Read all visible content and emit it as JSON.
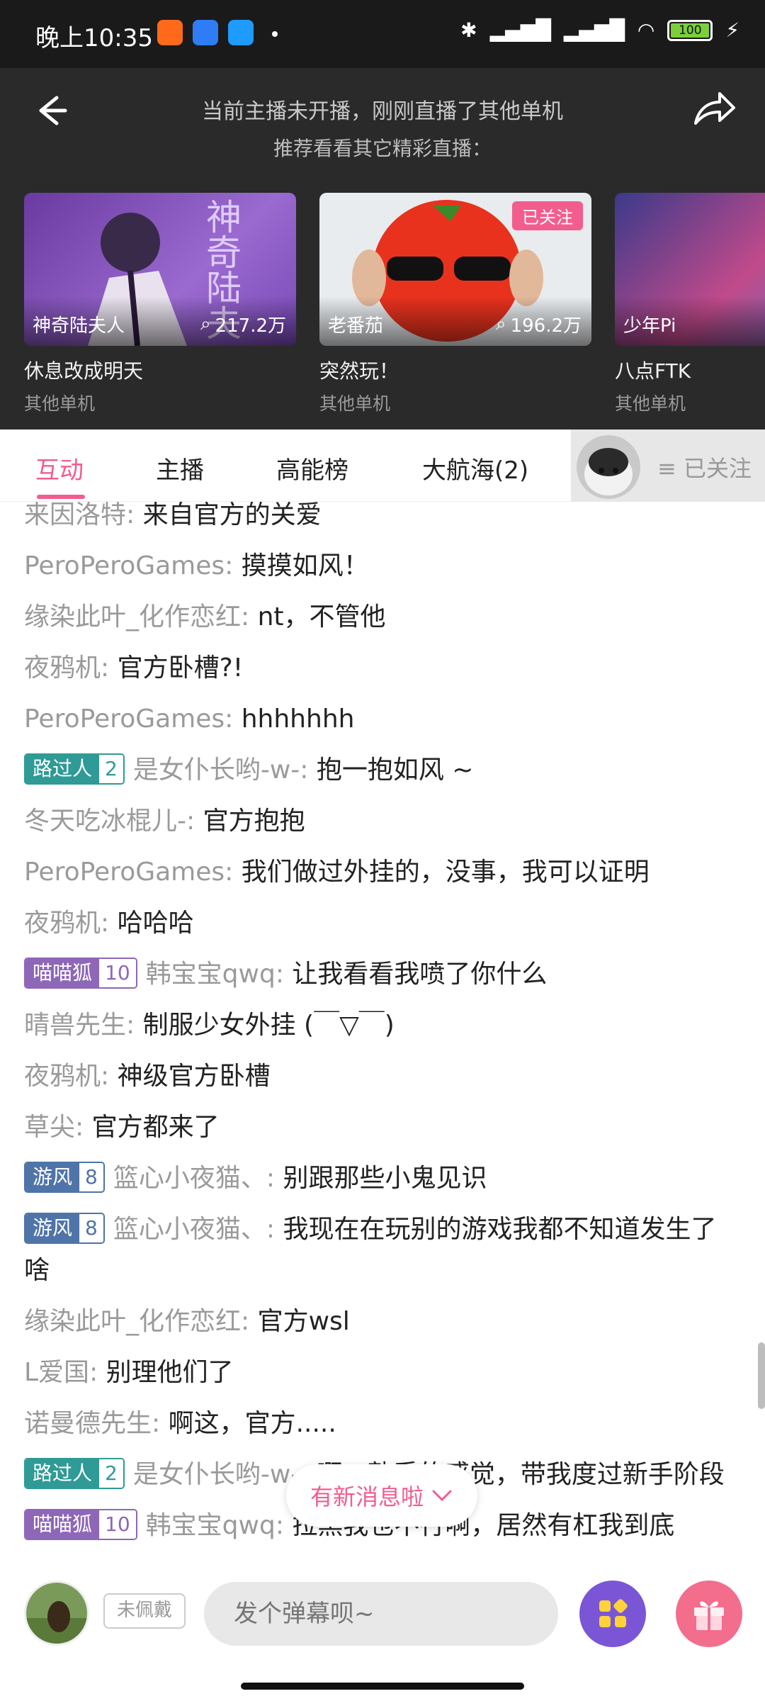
{
  "status_bar": {
    "time": "晚上10:35",
    "battery": "100"
  },
  "header": {
    "notice_line1": "当前主播未开播，刚刚直播了其他单机",
    "notice_line2": "推荐看看其它精彩直播："
  },
  "recommendations": [
    {
      "streamer": "神奇陆夫人",
      "viewers": "217.2万",
      "title": "休息改成明天",
      "category": "其他单机",
      "thumb_text": "神奇陆夫"
    },
    {
      "streamer": "老番茄",
      "viewers": "196.2万",
      "title": "突然玩！",
      "category": "其他单机",
      "followed_tag": "已关注"
    },
    {
      "streamer": "少年Pi",
      "viewers": "",
      "title": "八点FTK",
      "category": "其他单机"
    }
  ],
  "tabs": [
    {
      "label": "互动",
      "active": true
    },
    {
      "label": "主播"
    },
    {
      "label": "高能榜"
    },
    {
      "label": "大航海(2)"
    }
  ],
  "follow_button": "≡ 已关注",
  "chat": [
    {
      "user": "来因洛特",
      "text": "来自官方的关爱"
    },
    {
      "user": "PeroPeroGames",
      "text": "摸摸如风！"
    },
    {
      "user": "缘染此叶_化作恋红",
      "text": "nt，不管他"
    },
    {
      "user": "夜鸦机",
      "text": "官方卧槽?!"
    },
    {
      "user": "PeroPeroGames",
      "text": "hhhhhhh"
    },
    {
      "badge": {
        "name": "路过人",
        "level": "2",
        "color": "teal"
      },
      "user": "是女仆长哟-w-",
      "text": "抱一抱如风 ~"
    },
    {
      "user": "冬天吃冰棍儿-",
      "text": "官方抱抱"
    },
    {
      "user": "PeroPeroGames",
      "text": "我们做过外挂的，没事，我可以证明"
    },
    {
      "user": "夜鸦机",
      "text": "哈哈哈"
    },
    {
      "badge": {
        "name": "喵喵狐",
        "level": "10",
        "color": "purple"
      },
      "user": "韩宝宝qwq",
      "text": "让我看看我喷了你什么"
    },
    {
      "user": "晴兽先生",
      "text": "制服少女外挂 (￣▽￣)"
    },
    {
      "user": "夜鸦机",
      "text": "神级官方卧槽"
    },
    {
      "user": "草尖",
      "text": "官方都来了"
    },
    {
      "badge": {
        "name": "游风",
        "level": "8",
        "color": "blue"
      },
      "user": "篮心小夜猫、",
      "text": "别跟那些小鬼见识"
    },
    {
      "badge": {
        "name": "游风",
        "level": "8",
        "color": "blue"
      },
      "user": "篮心小夜猫、",
      "text": "我现在在玩别的游戏我都不知道发生了啥"
    },
    {
      "user": "缘染此叶_化作恋红",
      "text": "官方wsl"
    },
    {
      "user": "L爱国",
      "text": "别理他们了"
    },
    {
      "user": "诺曼德先生",
      "text": "啊这，官方....."
    },
    {
      "badge": {
        "name": "路过人",
        "level": "2",
        "color": "teal"
      },
      "user": "是女仆长哟-w-",
      "text": "啊，熟悉的感觉，带我度过新手阶段"
    },
    {
      "badge": {
        "name": "喵喵狐",
        "level": "10",
        "color": "purple"
      },
      "user": "韩宝宝qwq",
      "text": "拉黑我也不行啊，居然有杠我到底"
    }
  ],
  "new_message_pill": "有新消息啦",
  "bottom": {
    "wear_badge": "未佩戴",
    "input_placeholder": "发个弹幕呗~"
  },
  "colors": {
    "accent": "#f25d8e",
    "header_bg": "#2a2a2a",
    "teal_badge": "#2f9a96",
    "purple_badge": "#8e67b8",
    "blue_badge": "#4f74a8"
  }
}
